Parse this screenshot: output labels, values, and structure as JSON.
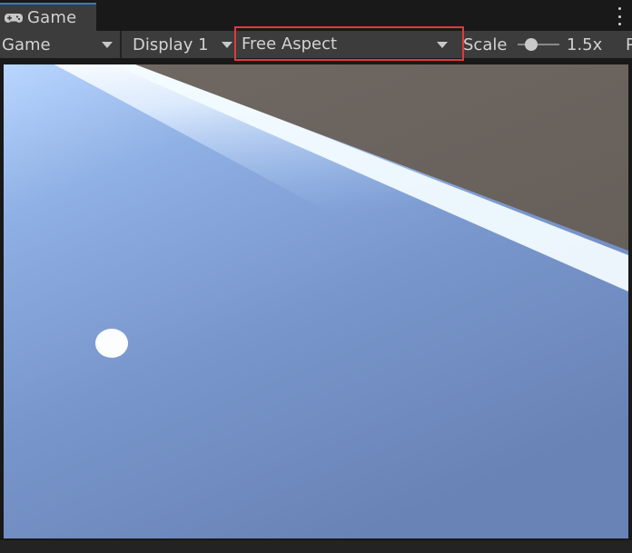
{
  "window": {
    "tab": {
      "label": "Game",
      "icon": "gamepad-icon"
    },
    "menu_icon": "kebab-menu-icon"
  },
  "toolbar": {
    "view_dropdown": "Game",
    "display_dropdown": "Display 1",
    "aspect_dropdown": "Free Aspect",
    "scale_label": "Scale",
    "scale_value": "1.5x",
    "scale_slider_level": 0.25,
    "overflow_label": "P"
  },
  "colors": {
    "highlight_border": "#e0393e",
    "tab_accent": "#3a79bb",
    "panel_bg": "#3c3c3c",
    "sky_blue": "#8fb0e0",
    "ground_gray": "#6b625e"
  }
}
